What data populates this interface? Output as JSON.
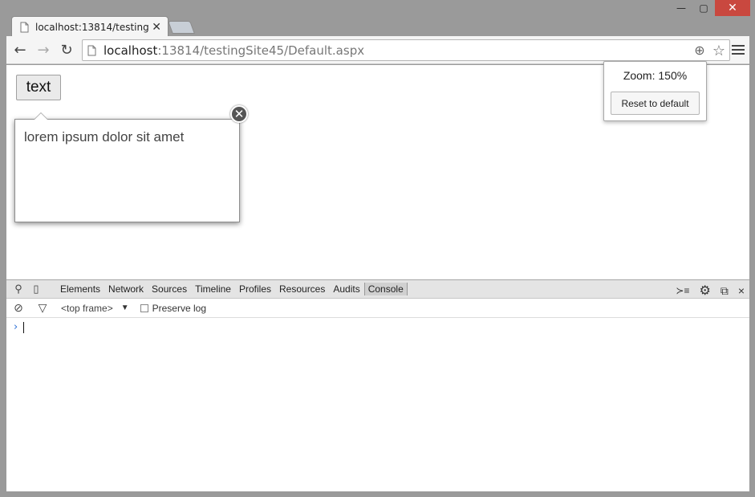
{
  "window": {
    "minimize_label": "—",
    "maximize_label": "▢",
    "close_label": "✕"
  },
  "tab": {
    "title": "localhost:13814/testingSite",
    "close_label": "✕"
  },
  "toolbar": {
    "back_label": "←",
    "forward_label": "→",
    "reload_label": "↻",
    "url_host": "localhost",
    "url_path": ":13814/testingSite45/Default.aspx",
    "zoom_icon": "⊕",
    "star_icon": "☆"
  },
  "page": {
    "button_label": "text",
    "popover_text": "lorem ipsum dolor sit amet",
    "popover_close_label": "✕"
  },
  "zoom_bubble": {
    "label": "Zoom: 150%",
    "reset_label": "Reset to default"
  },
  "devtools": {
    "search_icon": "⚲",
    "device_icon": "▯",
    "tabs": [
      "Elements",
      "Network",
      "Sources",
      "Timeline",
      "Profiles",
      "Resources",
      "Audits",
      "Console"
    ],
    "drawer_icon": "≻≡",
    "settings_icon": "⚙",
    "dock_icon": "⧉",
    "close_label": "×",
    "clear_icon": "⊘",
    "filter_icon": "▽",
    "frame_label": "<top frame>",
    "frame_caret": "▼",
    "preserve_log_label": "Preserve log",
    "prompt_symbol": "›"
  }
}
